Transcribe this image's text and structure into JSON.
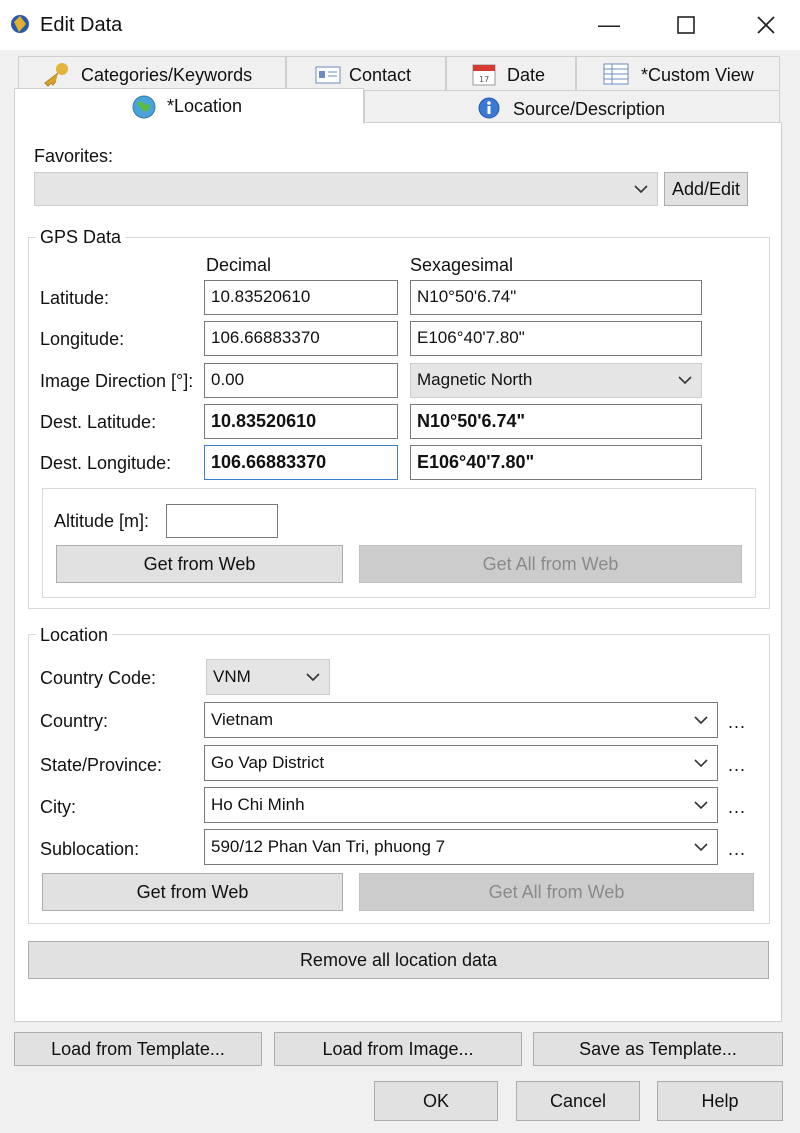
{
  "window": {
    "title": "Edit Data"
  },
  "tabs": {
    "categories": "Categories/Keywords",
    "contact": "Contact",
    "date": "Date",
    "custom_view": "*Custom View",
    "location": "*Location",
    "source": "Source/Description"
  },
  "favorites": {
    "label": "Favorites:",
    "value": "",
    "add_edit": "Add/Edit"
  },
  "gps": {
    "group": "GPS Data",
    "col_decimal": "Decimal",
    "col_sexagesimal": "Sexagesimal",
    "latitude": {
      "label": "Latitude:",
      "decimal": "10.83520610",
      "sexagesimal": "N10°50'6.74\""
    },
    "longitude": {
      "label": "Longitude:",
      "decimal": "106.66883370",
      "sexagesimal": "E106°40'7.80\""
    },
    "image_direction": {
      "label": "Image Direction [°]:",
      "decimal": "0.00",
      "reference": "Magnetic North"
    },
    "dest_latitude": {
      "label": "Dest. Latitude:",
      "decimal": "10.83520610",
      "sexagesimal": "N10°50'6.74\""
    },
    "dest_longitude": {
      "label": "Dest. Longitude:",
      "decimal": "106.66883370",
      "sexagesimal": "E106°40'7.80\""
    },
    "altitude": {
      "label": "Altitude [m]:",
      "value": ""
    },
    "get_from_web": "Get from Web",
    "get_all_from_web": "Get All from Web"
  },
  "location": {
    "group": "Location",
    "country_code": {
      "label": "Country Code:",
      "value": "VNM"
    },
    "country": {
      "label": "Country:",
      "value": "Vietnam"
    },
    "state": {
      "label": "State/Province:",
      "value": "Go Vap District"
    },
    "city": {
      "label": "City:",
      "value": "Ho Chi Minh"
    },
    "sublocation": {
      "label": "Sublocation:",
      "value": "590/12 Phan Van Tri, phuong 7"
    },
    "more": "...",
    "get_from_web": "Get from Web",
    "get_all_from_web": "Get All from Web",
    "remove_all": "Remove all location data"
  },
  "footer": {
    "load_template": "Load from Template...",
    "load_image": "Load from Image...",
    "save_template": "Save as Template...",
    "ok": "OK",
    "cancel": "Cancel",
    "help": "Help"
  }
}
